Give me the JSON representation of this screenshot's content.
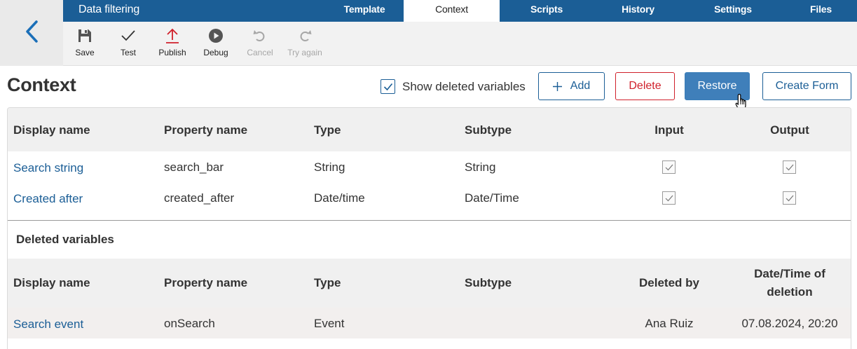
{
  "app": {
    "title": "Data filtering"
  },
  "tabs": [
    {
      "label": "Template",
      "active": false
    },
    {
      "label": "Context",
      "active": true
    },
    {
      "label": "Scripts",
      "active": false
    },
    {
      "label": "History",
      "active": false
    },
    {
      "label": "Settings",
      "active": false
    },
    {
      "label": "Files",
      "active": false
    }
  ],
  "toolbar": {
    "save": {
      "label": "Save",
      "icon": "floppy-disk-icon"
    },
    "test": {
      "label": "Test",
      "icon": "checkmark-icon"
    },
    "publish": {
      "label": "Publish",
      "icon": "upload-arrow-icon"
    },
    "debug": {
      "label": "Debug",
      "icon": "play-circle-icon"
    },
    "cancel": {
      "label": "Cancel",
      "icon": "undo-icon",
      "disabled": true
    },
    "try_again": {
      "label": "Try again",
      "icon": "redo-icon",
      "disabled": true
    }
  },
  "page": {
    "title": "Context",
    "show_deleted": {
      "label": "Show deleted variables",
      "checked": true
    },
    "buttons": {
      "add": "Add",
      "delete": "Delete",
      "restore": "Restore",
      "create_form": "Create Form"
    }
  },
  "variables": {
    "columns": {
      "display_name": "Display name",
      "property_name": "Property name",
      "type": "Type",
      "subtype": "Subtype",
      "input": "Input",
      "output": "Output"
    },
    "rows": [
      {
        "display_name": "Search string",
        "property_name": "search_bar",
        "type": "String",
        "subtype": "String",
        "input": true,
        "output": true
      },
      {
        "display_name": "Created after",
        "property_name": "created_after",
        "type": "Date/time",
        "subtype": "Date/Time",
        "input": true,
        "output": true
      }
    ]
  },
  "deleted": {
    "title": "Deleted variables",
    "columns": {
      "display_name": "Display name",
      "property_name": "Property name",
      "type": "Type",
      "subtype": "Subtype",
      "deleted_by": "Deleted by",
      "date_line1": "Date/Time of",
      "date_line2": "deletion"
    },
    "rows": [
      {
        "display_name": "Search event",
        "property_name": "onSearch",
        "type": "Event",
        "subtype": "",
        "deleted_by": "Ana Ruiz",
        "date": "07.08.2024, 20:20"
      }
    ]
  },
  "colors": {
    "brand": "#1b5e96",
    "danger": "#d0202b",
    "restore": "#3f7fba",
    "disabled": "#a6a6a6"
  }
}
